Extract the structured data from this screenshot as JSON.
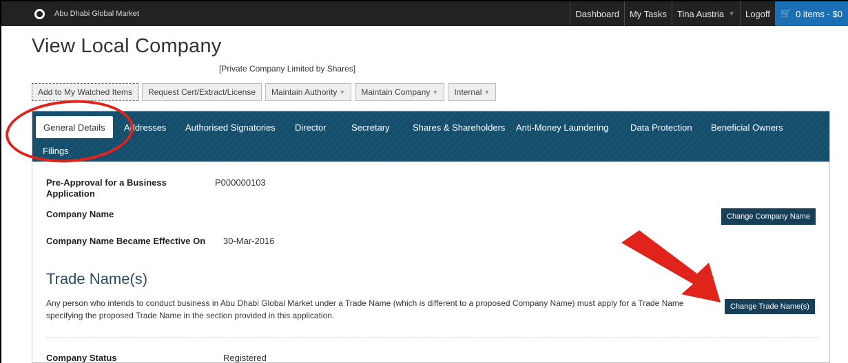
{
  "navbar": {
    "brand": "Abu Dhabi Global Market",
    "items": [
      "Dashboard",
      "My Tasks"
    ],
    "user": "Tina Austria",
    "logoff": "Logoff",
    "cart": "0 items - $0"
  },
  "page": {
    "title": "View Local Company",
    "company_type": "[Private Company Limited by Shares]"
  },
  "actions": [
    {
      "label": "Add to My Watched Items"
    },
    {
      "label": "Request Cert/Extract/License"
    },
    {
      "label": "Maintain Authority"
    },
    {
      "label": "Maintain Company"
    },
    {
      "label": "Internal"
    }
  ],
  "tabs": [
    "General Details",
    "Addresses",
    "Authorised Signatories",
    "Director",
    "Secretary",
    "Shares & Shareholders",
    "Anti-Money Laundering",
    "Data Protection",
    "Beneficial Owners",
    "Filings"
  ],
  "details": {
    "preapproval_label": "Pre-Approval for a Business Application",
    "preapproval_value": "P000000103",
    "company_name_label": "Company Name",
    "company_name_value": "",
    "change_company_name": "Change Company Name",
    "effective_label": "Company Name Became Effective On",
    "effective_value": "30-Mar-2016"
  },
  "trade": {
    "title": "Trade Name(s)",
    "description": "Any person who intends to conduct business in Abu Dhabi Global Market under a Trade Name (which is different to a proposed Company Name) must apply for a Trade Name specifying the proposed Trade Name in the section provided in this application.",
    "button": "Change Trade Name(s)"
  },
  "status": {
    "label": "Company Status",
    "value": "Registered"
  },
  "colors": {
    "navbar": "#222222",
    "tabbar": "#154e6c",
    "button_dark": "#173f58",
    "cart": "#1a6fb5",
    "annotation": "#e0241b"
  }
}
